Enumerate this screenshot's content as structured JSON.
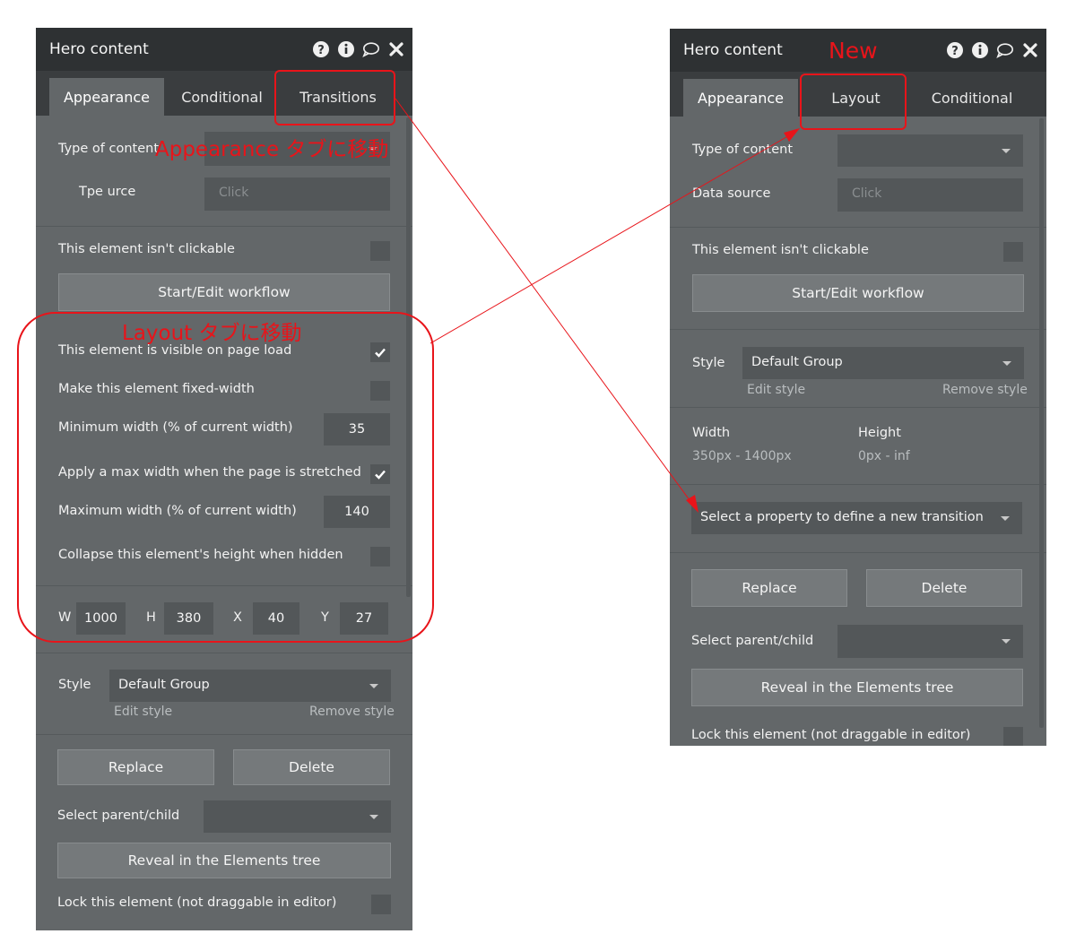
{
  "left_panel": {
    "title": "Hero content",
    "tabs": [
      "Appearance",
      "Conditional",
      "Transitions"
    ],
    "type_of_content_label": "Type of content",
    "data_source_label": "Tpe urce",
    "click_placeholder": "Click",
    "not_clickable_label": "This element isn't clickable",
    "workflow_button": "Start/Edit workflow",
    "visible_on_load_label": "This element is visible on page load",
    "fixed_width_label": "Make this element fixed-width",
    "min_width_label": "Minimum width (% of current width)",
    "min_width_value": "35",
    "apply_max_label": "Apply a max width when the page is stretched",
    "max_width_label": "Maximum width (% of current width)",
    "max_width_value": "140",
    "collapse_label": "Collapse this element's height when hidden",
    "dims": {
      "w_label": "W",
      "w_value": "1000",
      "h_label": "H",
      "h_value": "380",
      "x_label": "X",
      "x_value": "40",
      "y_label": "Y",
      "y_value": "27"
    },
    "style_label": "Style",
    "style_value": "Default Group",
    "edit_style": "Edit style",
    "remove_style": "Remove style",
    "replace_button": "Replace",
    "delete_button": "Delete",
    "parent_child_label": "Select parent/child",
    "reveal_button": "Reveal in the Elements tree",
    "lock_label": "Lock this element (not draggable in editor)"
  },
  "right_panel": {
    "title": "Hero content",
    "tabs": [
      "Appearance",
      "Layout",
      "Conditional"
    ],
    "type_of_content_label": "Type of content",
    "data_source_label": "Data source",
    "click_placeholder": "Click",
    "not_clickable_label": "This element isn't clickable",
    "workflow_button": "Start/Edit workflow",
    "style_label": "Style",
    "style_value": "Default Group",
    "edit_style": "Edit style",
    "remove_style": "Remove style",
    "width_label": "Width",
    "width_value": "350px - 1400px",
    "height_label": "Height",
    "height_value": "0px - inf",
    "transition_select": "Select a property to define a new transition",
    "replace_button": "Replace",
    "delete_button": "Delete",
    "parent_child_label": "Select parent/child",
    "reveal_button": "Reveal in the Elements tree",
    "lock_label": "Lock this element (not draggable in editor)"
  },
  "annotations": {
    "appearance_move": "Appearance タブに移動",
    "layout_move": "Layout タブに移動",
    "new_label": "New",
    "color": "#e8141a"
  },
  "icons": [
    "help-icon",
    "info-icon",
    "comment-icon",
    "close-icon",
    "checkmark-icon",
    "chevron-down-icon"
  ],
  "colors": {
    "panel_bg": "#636769",
    "header_bg": "#2e3133",
    "tabbar_bg": "#3a3d3f",
    "field_bg": "#535759",
    "button_bg": "#75797b"
  }
}
